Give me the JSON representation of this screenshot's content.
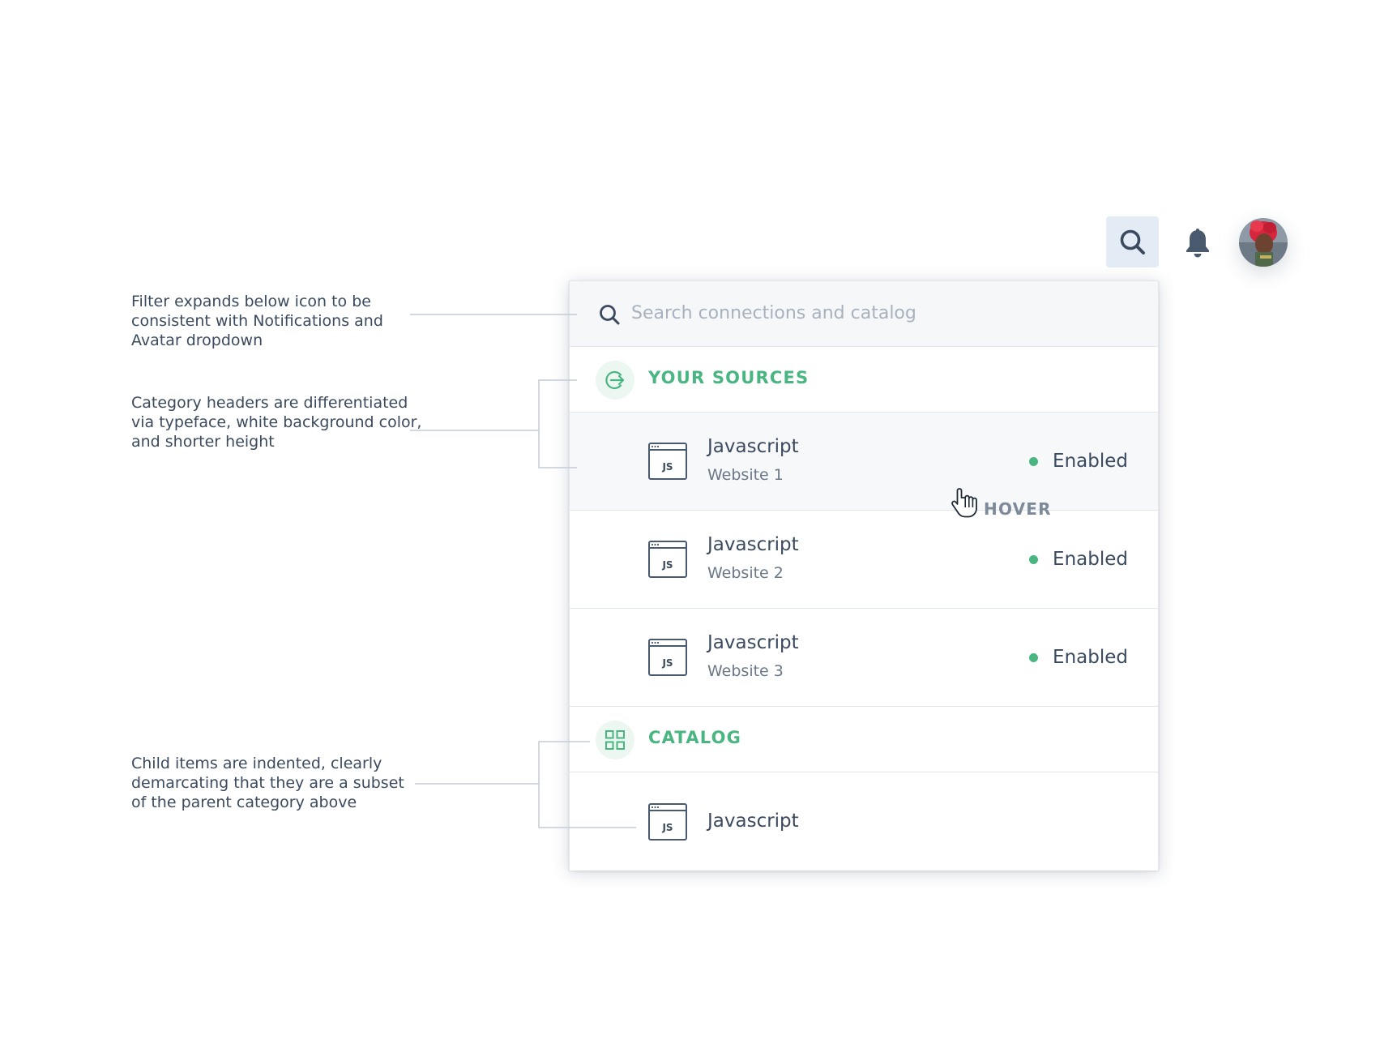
{
  "topbar": {
    "search_icon": "search-icon",
    "bell_icon": "bell-icon",
    "avatar": "avatar"
  },
  "search": {
    "placeholder": "Search connections and catalog",
    "value": ""
  },
  "categories": [
    {
      "label": "YOUR SOURCES",
      "icon": "sign-out-circle-icon",
      "items": [
        {
          "name": "Javascript",
          "sub": "Website 1",
          "status": "Enabled",
          "icon": "js-icon",
          "hovered": true
        },
        {
          "name": "Javascript",
          "sub": "Website 2",
          "status": "Enabled",
          "icon": "js-icon"
        },
        {
          "name": "Javascript",
          "sub": "Website 3",
          "status": "Enabled",
          "icon": "js-icon"
        }
      ]
    },
    {
      "label": "CATALOG",
      "icon": "grid-icon",
      "items": [
        {
          "name": "Javascript",
          "icon": "js-icon"
        }
      ]
    }
  ],
  "js_icon_text": "JS",
  "hover_label": "HOVER",
  "notes": {
    "filter": "Filter expands below icon to be consistent with Notifications and Avatar dropdown",
    "headers": "Category headers are differentiated via typeface, white background color, and shorter height",
    "children": "Child items are indented, clearly demarcating that they are a subset of the parent category above"
  },
  "colors": {
    "accent_green": "#49b681",
    "text": "#3b4a5e",
    "search_button_bg": "#e3ecf5",
    "hover_row_bg": "#f7f8fa"
  }
}
